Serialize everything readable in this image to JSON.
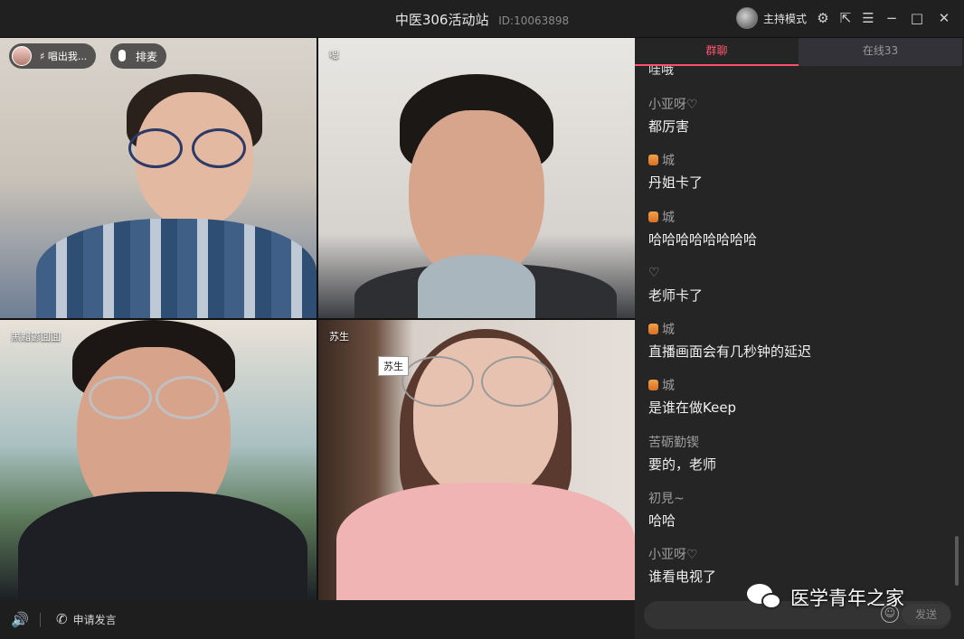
{
  "window": {
    "title": "中医306活动站",
    "room_id": "ID:10063898",
    "host_mode_label": "主持模式"
  },
  "tiles": [
    {
      "name": "",
      "sing_badge": "♯ 唱出我...",
      "mic_badge": "排麦"
    },
    {
      "name": "嗯"
    },
    {
      "name": "黑黯鬱囬囬"
    },
    {
      "name": "苏生",
      "tooltip": "苏生"
    }
  ],
  "bottombar": {
    "apply_label": "申请发言"
  },
  "chat": {
    "tabs": [
      {
        "label": "群聊",
        "active": true
      },
      {
        "label": "在线33",
        "active": false
      }
    ],
    "partial_top": "哇哦",
    "messages": [
      {
        "user": "小亚呀♡",
        "text": "都厉害",
        "has_icon": false
      },
      {
        "user": "城",
        "text": "丹姐卡了",
        "has_icon": true
      },
      {
        "user": "城",
        "text": "哈哈哈哈哈哈哈哈",
        "has_icon": true
      },
      {
        "user": "♡",
        "text": "老师卡了",
        "has_icon": false
      },
      {
        "user": "城",
        "text": "直播画面会有几秒钟的延迟",
        "has_icon": true
      },
      {
        "user": "城",
        "text": "是谁在做Keep",
        "has_icon": true
      },
      {
        "user": "苦砺勤锲",
        "text": "要的，老师",
        "has_icon": false
      },
      {
        "user": "初見~",
        "text": "哈哈",
        "has_icon": false
      },
      {
        "user": "小亚呀♡",
        "text": "谁看电视了",
        "has_icon": false
      }
    ],
    "send_label": "发送",
    "watermark": "医学青年之家"
  },
  "colors": {
    "accent": "#ff4f6a",
    "background": "#1b1b1b",
    "panel": "#252526"
  }
}
